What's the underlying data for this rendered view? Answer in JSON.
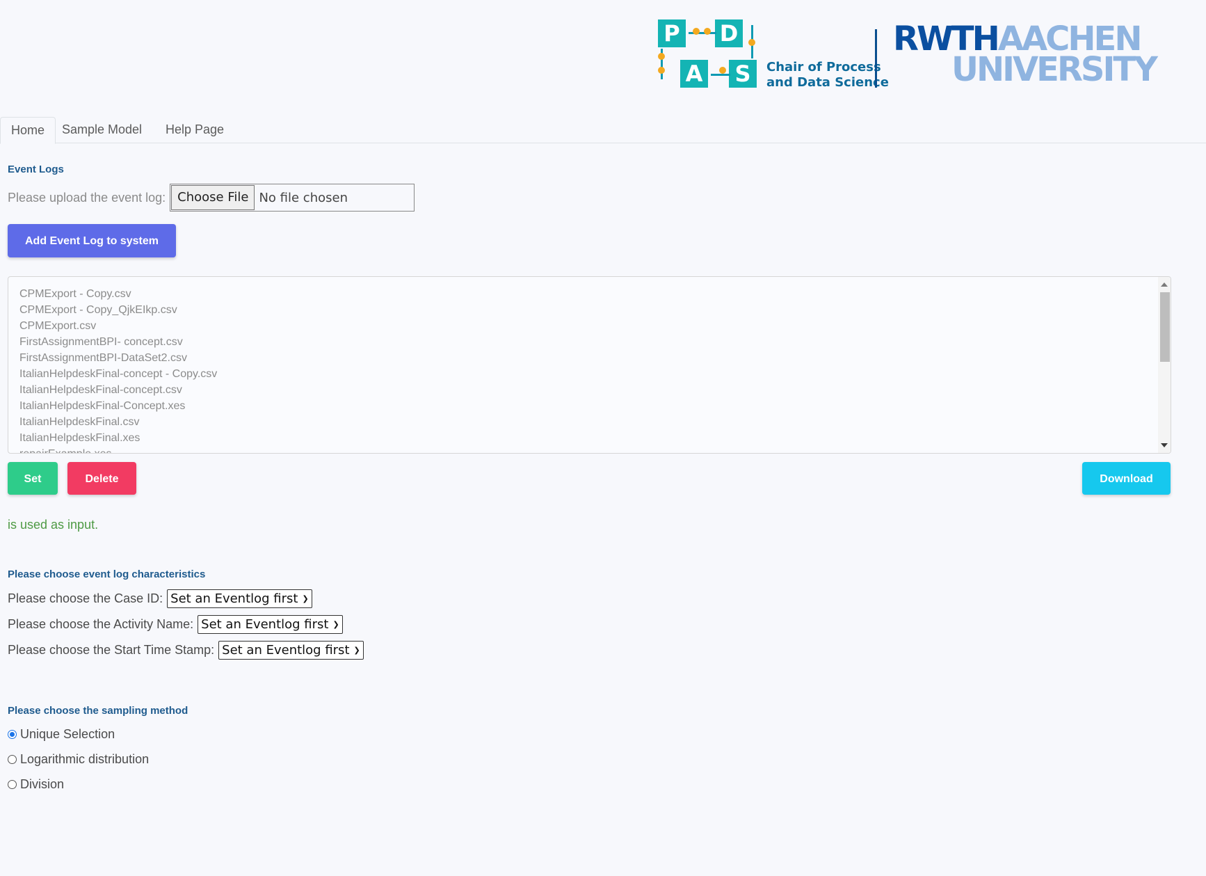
{
  "header": {
    "pads_letters": [
      "P",
      "D",
      "A",
      "S"
    ],
    "chair_line1": "Chair of Process",
    "chair_line2": "and Data Science",
    "rwth_bold": "RWTH",
    "rwth_light": "AACHEN",
    "rwth_line2": "UNIVERSITY"
  },
  "tabs": [
    {
      "label": "Home",
      "active": true
    },
    {
      "label": "Sample Model",
      "active": false
    },
    {
      "label": "Help Page",
      "active": false
    }
  ],
  "event_logs": {
    "title": "Event Logs",
    "upload_label": "Please upload the event log:",
    "choose_file": "Choose File",
    "no_file": "No file chosen",
    "add_button": "Add Event Log to system",
    "files": [
      "CPMExport - Copy.csv",
      "CPMExport - Copy_QjkEIkp.csv",
      "CPMExport.csv",
      "FirstAssignmentBPI- concept.csv",
      "FirstAssignmentBPI-DataSet2.csv",
      "ItalianHelpdeskFinal-concept - Copy.csv",
      "ItalianHelpdeskFinal-concept.csv",
      "ItalianHelpdeskFinal-Concept.xes",
      "ItalianHelpdeskFinal.csv",
      "ItalianHelpdeskFinal.xes",
      "repairExample.xes"
    ],
    "set_button": "Set",
    "delete_button": "Delete",
    "download_button": "Download",
    "status_text": "is used as input."
  },
  "characteristics": {
    "title": "Please choose event log characteristics",
    "case_id_label": "Please choose the Case ID:",
    "activity_label": "Please choose the Activity Name:",
    "timestamp_label": "Please choose the Start Time Stamp:",
    "select_value": "Set an Eventlog first"
  },
  "sampling": {
    "title": "Please choose the sampling method",
    "options": [
      {
        "label": "Unique Selection",
        "checked": true
      },
      {
        "label": "Logarithmic distribution",
        "checked": false
      },
      {
        "label": "Division",
        "checked": false
      }
    ]
  },
  "colors": {
    "add_button": "#5e6be8",
    "set_button": "#2ecc8a",
    "delete_button": "#f23b62",
    "download_button": "#16c8ee",
    "heading": "#1f5b8e",
    "status_green": "#4e9a44"
  }
}
